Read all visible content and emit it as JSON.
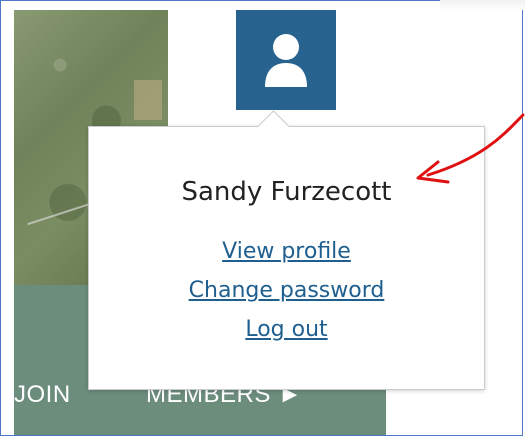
{
  "account_menu": {
    "user_name": "Sandy Furzecott",
    "links": {
      "view_profile": "View profile",
      "change_password": "Change password",
      "log_out": "Log out"
    }
  },
  "nav": {
    "join_label": "JOIN",
    "members_label": "MEMBERS ►"
  },
  "icons": {
    "avatar": "user-icon"
  },
  "colors": {
    "avatar_button_bg": "#28628f",
    "link": "#1f5f8f",
    "nav_band": "#6c8c7c",
    "annotation": "#e01010"
  }
}
